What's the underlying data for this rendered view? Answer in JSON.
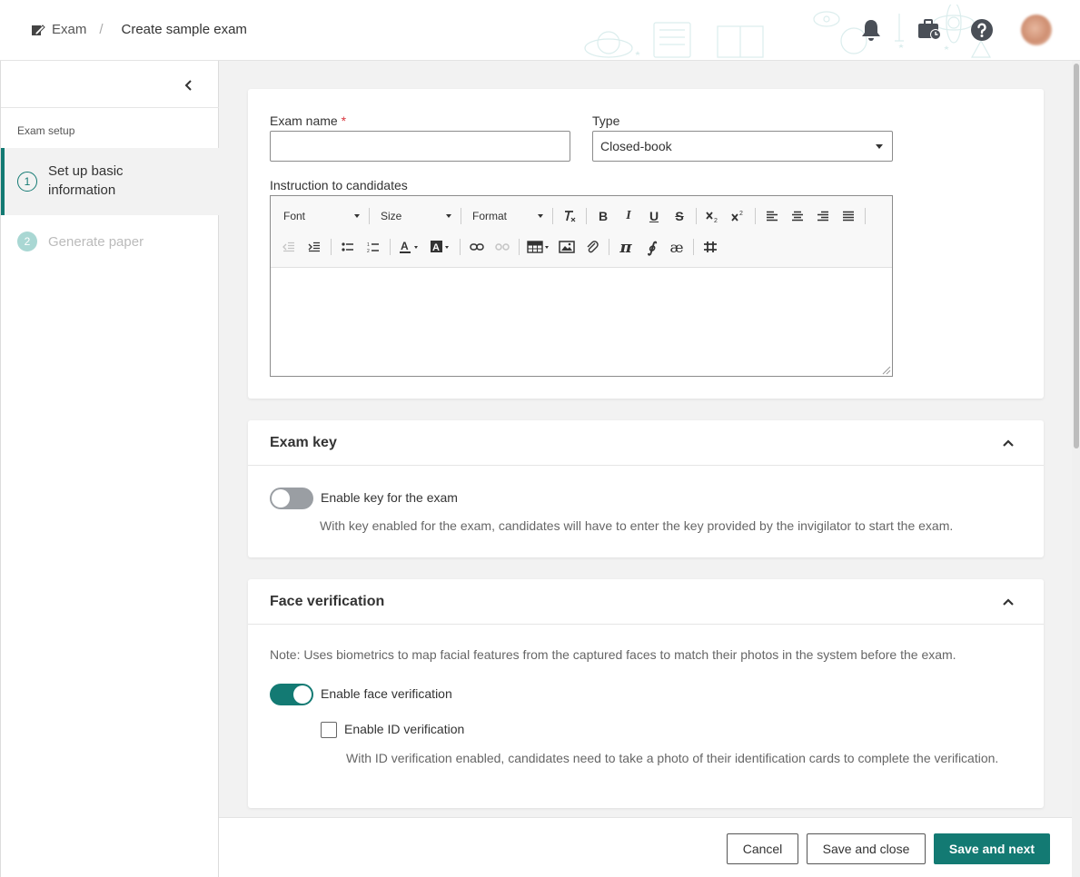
{
  "header": {
    "breadcrumb_root": "Exam",
    "breadcrumb_separator": "/",
    "breadcrumb_current": "Create sample exam",
    "icons": [
      "bell-icon",
      "briefcase-clock-icon",
      "help-icon",
      "avatar"
    ]
  },
  "sidebar": {
    "section_title": "Exam setup",
    "steps": [
      {
        "number": "1",
        "label": "Set up basic information",
        "state": "active"
      },
      {
        "number": "2",
        "label": "Generate paper",
        "state": "disabled"
      }
    ]
  },
  "basic": {
    "exam_name_label": "Exam name",
    "required_mark": "*",
    "exam_name_value": "",
    "type_label": "Type",
    "type_value": "Closed-book",
    "instruction_label": "Instruction to candidates",
    "toolbar": {
      "font": "Font",
      "size": "Size",
      "format": "Format"
    }
  },
  "exam_key": {
    "title": "Exam key",
    "toggle_label": "Enable key for the exam",
    "toggle_on": false,
    "hint": "With key enabled for the exam, candidates will have to enter the key provided by the invigilator to start the exam."
  },
  "face": {
    "title": "Face verification",
    "note": "Note: Uses biometrics to map facial features from the captured faces to match their photos in the system before the exam.",
    "toggle_label": "Enable face verification",
    "toggle_on": true,
    "id_label": "Enable ID verification",
    "id_checked": false,
    "id_hint": "With ID verification enabled, candidates need to take a photo of their identification cards to complete the verification."
  },
  "footer": {
    "cancel": "Cancel",
    "save_close": "Save and close",
    "save_next": "Save and next"
  },
  "colors": {
    "accent": "#137a73",
    "required": "#d9363e"
  }
}
